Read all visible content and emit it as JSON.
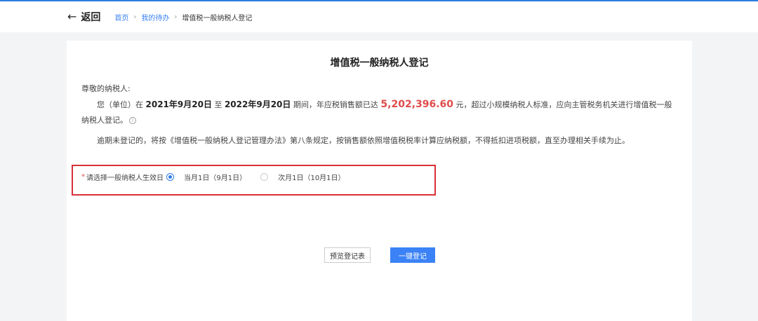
{
  "header": {
    "back_arrow": "←",
    "back_label": "返回",
    "breadcrumb": [
      "首页",
      "我的待办",
      "增值税一般纳税人登记"
    ],
    "separator": "›"
  },
  "card": {
    "title": "增值税一般纳税人登记",
    "greeting": "尊敬的纳税人:",
    "p1": {
      "t1": "您（单位）在 ",
      "start_date": "2021年9月20日",
      "t2": " 至 ",
      "end_date": "2022年9月20日",
      "t3": " 期间，年应税销售额已达 ",
      "amount": "5,202,396.60",
      "t4": " 元，超过小规模纳税人标准，应向主管税务机关进行增值税一般纳税人登记。"
    },
    "info_icon": "i",
    "p2": "逾期未登记的，将按《增值税一般纳税人登记管理办法》第八条规定，按销售额依照增值税税率计算应纳税额，不得抵扣进项税额，直至办理相关手续为止。",
    "effective": {
      "required_mark": "*",
      "label": "请选择一般纳税人生效日",
      "options": [
        {
          "label": "当月1日（9月1日）",
          "checked": true
        },
        {
          "label": "次月1日（10月1日）",
          "checked": false
        }
      ]
    },
    "buttons": {
      "preview": "预览登记表",
      "register": "一键登记"
    }
  },
  "colors": {
    "accent": "#3b82f6",
    "amount": "#e04c4c",
    "highlight_border": "#d9303a"
  }
}
